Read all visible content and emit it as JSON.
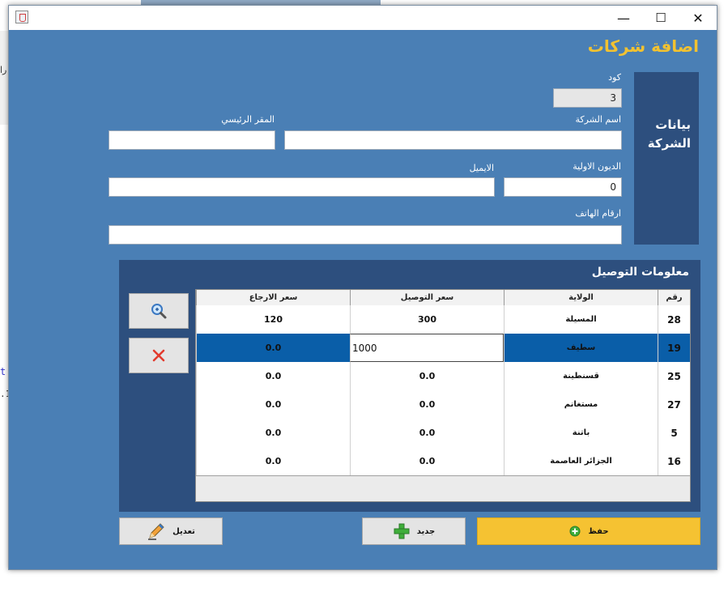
{
  "window": {
    "controls": {
      "minimize": "—",
      "maximize": "☐",
      "close": "✕"
    }
  },
  "form": {
    "title": "اضافة شركات",
    "side_label": "بيانات الشركة",
    "code_label": "كود",
    "code_value": "3",
    "company_name_label": "اسم الشركة",
    "company_name_value": "",
    "hq_label": "المقر الرئيسي",
    "hq_value": "",
    "initial_debt_label": "الديون الاولية",
    "initial_debt_value": "0",
    "email_label": "الايميل",
    "email_value": "",
    "phones_label": "ارقام الهاتف",
    "phones_value": ""
  },
  "delivery": {
    "title": "معلومات التوصيل",
    "columns": [
      "رقم",
      "الولاية",
      "سعر التوصيل",
      "سعر الارجاع"
    ],
    "rows": [
      {
        "num": "28",
        "wilaya": "المسيلة",
        "delivery": "300",
        "return": "120"
      },
      {
        "num": "19",
        "wilaya": "سطيف",
        "delivery": "1000",
        "return": "0.0"
      },
      {
        "num": "25",
        "wilaya": "قسنطينة",
        "delivery": "0.0",
        "return": "0.0"
      },
      {
        "num": "27",
        "wilaya": "مستغانم",
        "delivery": "0.0",
        "return": "0.0"
      },
      {
        "num": "5",
        "wilaya": "باتنة",
        "delivery": "0.0",
        "return": "0.0"
      },
      {
        "num": "16",
        "wilaya": "الجزائر العاصمة",
        "delivery": "0.0",
        "return": "0.0"
      }
    ],
    "search_icon": "search-icon",
    "delete_icon": "delete-icon"
  },
  "buttons": {
    "edit_label": "تعديل",
    "new_label": "جديد",
    "save_label": "حفظ"
  },
  "background": {
    "left_text_1": "را",
    "left_text_2": "t",
    "left_text_3": ".1"
  },
  "colors": {
    "window_bg": "#4a7fb5",
    "panel_bg": "#2d4f7e",
    "title_color": "#f2c230",
    "save_button": "#f5c232",
    "selected_row": "#0a5ea8"
  }
}
